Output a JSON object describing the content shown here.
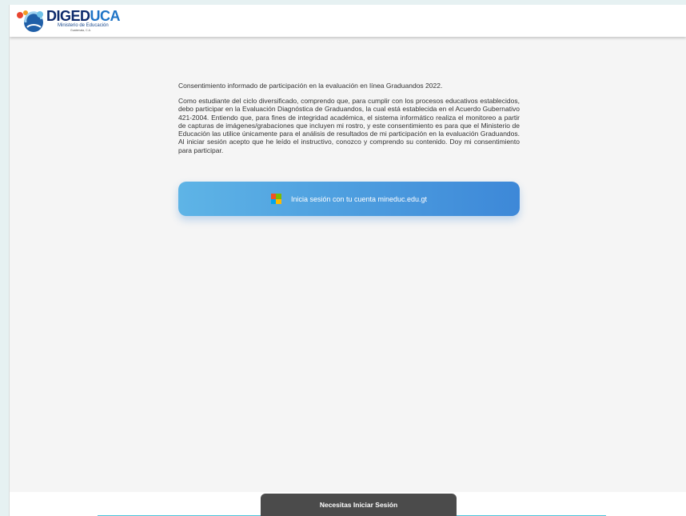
{
  "header": {
    "logo_name_dark": "DIGED",
    "logo_name_light": "UCA",
    "logo_subtitle": "Ministerio de Educación",
    "logo_country": "Guatemala, C.A."
  },
  "consent": {
    "title": "Consentimiento informado de participación en la evaluación en línea Graduandos 2022.",
    "body": "Como estudiante del ciclo diversificado, comprendo que, para cumplir con los procesos educativos establecidos, debo participar en la Evaluación Diagnóstica de Graduandos, la cual está establecida en el Acuerdo Gubernativo 421-2004. Entiendo que, para fines de integridad académica, el sistema informático realiza el monitoreo a partir de capturas de imágenes/grabaciones que incluyen mi rostro, y este consentimiento es para que el Ministerio de Educación las utilice únicamente para el análisis de resultados de mi participación en la evaluación Graduandos. Al iniciar sesión acepto que he leído el instructivo, conozco y comprendo su contenido. Doy mi consentimiento para participar."
  },
  "login": {
    "label": "Inicia sesión con tu cuenta mineduc.edu.gt",
    "icon": "microsoft-icon",
    "icon_colors": [
      "#f25022",
      "#7fba00",
      "#00a4ef",
      "#ffb900"
    ]
  },
  "toast": {
    "message": "Necesitas Iniciar Sesión"
  },
  "colors": {
    "button_gradient_start": "#5eb4e6",
    "button_gradient_end": "#3d88d8",
    "toast_bg": "#4b4b4b",
    "accent_line": "#4ec3d9"
  }
}
